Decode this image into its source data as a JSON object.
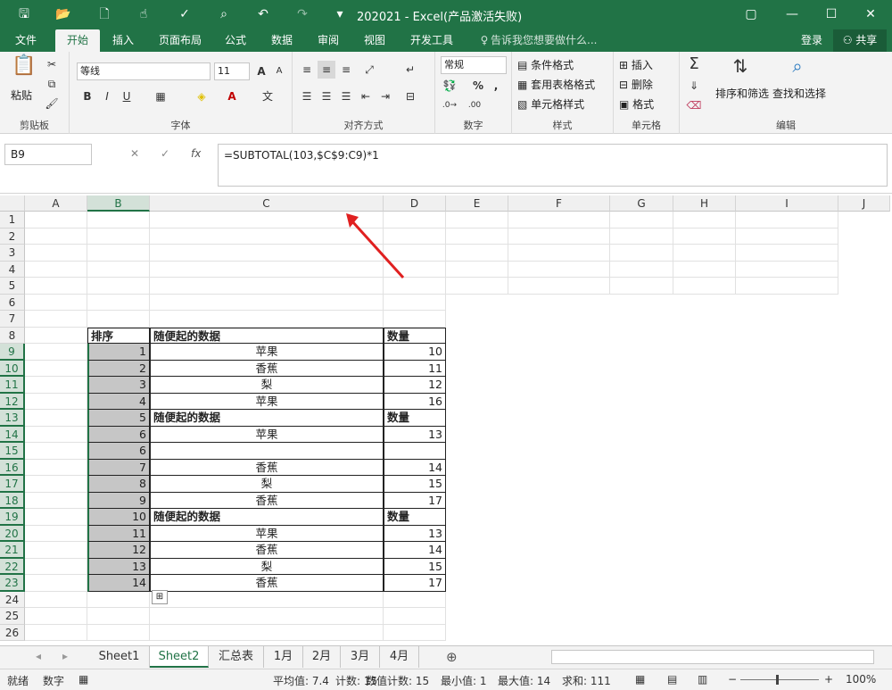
{
  "title": "202021 - Excel(产品激活失败)",
  "quick_access": [
    "save-icon",
    "open-icon",
    "new-icon",
    "touch-icon",
    "spellcheck-icon",
    "preview-icon",
    "undo-icon",
    "redo-icon",
    "customize-icon"
  ],
  "window_buttons": {
    "restore": "▢",
    "minimize": "—",
    "maximize": "☐",
    "close": "✕"
  },
  "tabs": [
    "文件",
    "开始",
    "插入",
    "页面布局",
    "公式",
    "数据",
    "审阅",
    "视图",
    "开发工具"
  ],
  "tell_me": "告诉我您想要做什么...",
  "login": "登录",
  "share": "共享",
  "ribbon": {
    "clipboard": {
      "paste": "粘贴",
      "label": "剪贴板"
    },
    "font": {
      "name": "等线",
      "size": "11",
      "label": "字体",
      "bold": "B",
      "italic": "I",
      "underline": "U",
      "grow": "A",
      "shrink": "A"
    },
    "alignment": {
      "label": "对齐方式"
    },
    "number": {
      "format": "常规",
      "label": "数字",
      "percent": "%",
      "comma": ","
    },
    "styles": {
      "conditional": "条件格式",
      "table": "套用表格格式",
      "cell": "单元格样式",
      "label": "样式"
    },
    "cells": {
      "insert": "插入",
      "delete": "删除",
      "format": "格式",
      "label": "单元格"
    },
    "editing": {
      "sort": "排序和筛选",
      "find": "查找和选择",
      "label": "编辑"
    }
  },
  "name_box": "B9",
  "formula": "=SUBTOTAL(103,$C$9:C9)*1",
  "columns": [
    "A",
    "B",
    "C",
    "D",
    "E",
    "F",
    "G",
    "H",
    "I",
    "J"
  ],
  "rows": [
    "1",
    "2",
    "3",
    "4",
    "5",
    "6",
    "7",
    "8",
    "9",
    "10",
    "11",
    "12",
    "13",
    "14",
    "15",
    "16",
    "17",
    "18",
    "19",
    "20",
    "21",
    "22",
    "23",
    "24",
    "25",
    "26"
  ],
  "table_rows": [
    {
      "b": "排序",
      "c": "随便起的数据",
      "d": "数量",
      "header": true
    },
    {
      "b": "1",
      "c": "苹果",
      "d": "10"
    },
    {
      "b": "2",
      "c": "香蕉",
      "d": "11"
    },
    {
      "b": "3",
      "c": "梨",
      "d": "12"
    },
    {
      "b": "4",
      "c": "苹果",
      "d": "16"
    },
    {
      "b": "5",
      "c": "随便起的数据",
      "d": "数量",
      "header": true
    },
    {
      "b": "6",
      "c": "苹果",
      "d": "13"
    },
    {
      "b": "6",
      "c": "",
      "d": ""
    },
    {
      "b": "7",
      "c": "香蕉",
      "d": "14"
    },
    {
      "b": "8",
      "c": "梨",
      "d": "15"
    },
    {
      "b": "9",
      "c": "香蕉",
      "d": "17"
    },
    {
      "b": "10",
      "c": "随便起的数据",
      "d": "数量",
      "header": true
    },
    {
      "b": "11",
      "c": "苹果",
      "d": "13"
    },
    {
      "b": "12",
      "c": "香蕉",
      "d": "14"
    },
    {
      "b": "13",
      "c": "梨",
      "d": "15"
    },
    {
      "b": "14",
      "c": "香蕉",
      "d": "17"
    }
  ],
  "sheets": [
    "Sheet1",
    "Sheet2",
    "汇总表",
    "1月",
    "2月",
    "3月",
    "4月"
  ],
  "active_sheet": "Sheet2",
  "status": {
    "mode": "就绪",
    "num": "数字",
    "average": "平均值: 7.4",
    "count": "计数: 15",
    "numcount": "数值计数: 15",
    "min": "最小值: 1",
    "max": "最大值: 14",
    "sum": "求和: 111",
    "zoom": "100%"
  },
  "colors": {
    "accent": "#217346",
    "selection": "#c6c6c6",
    "arrow": "#e02020"
  }
}
